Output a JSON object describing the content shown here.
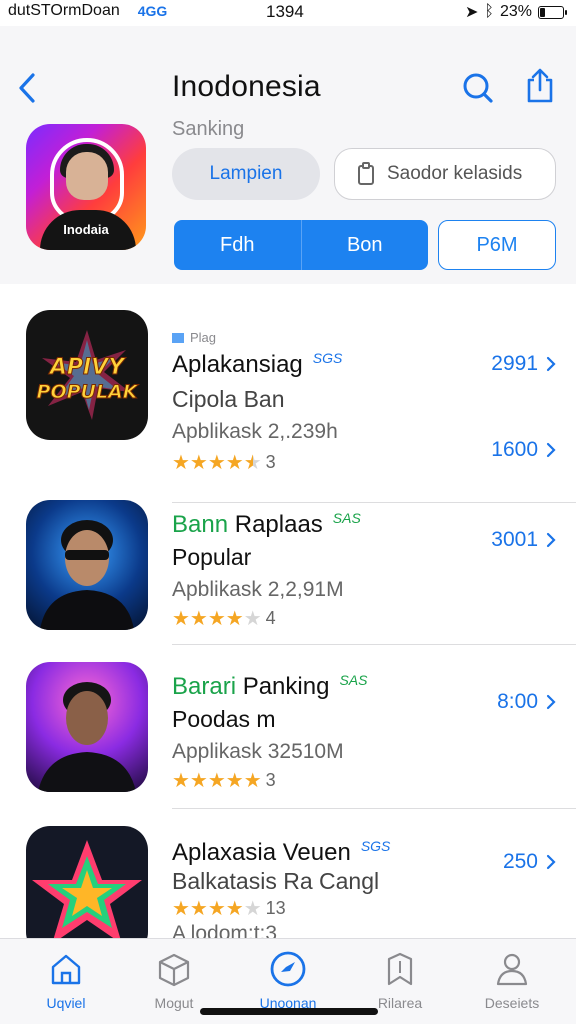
{
  "status_bar": {
    "carrier": "dutSTOrmDoan",
    "network": "4GG",
    "time": "1394",
    "battery": "23%",
    "battery_level": 0.23
  },
  "header": {
    "title": "Inodonesia",
    "subtitle": "Sanking",
    "hero_caption": "Inodaia",
    "primary_button": "Lampien",
    "secondary_button": "Saodor kelasids",
    "segments": [
      "Fdh",
      "Bon"
    ],
    "outline_button": "P6M"
  },
  "list": {
    "items": [
      {
        "flag": "Plag",
        "title_green": "",
        "title": "Aplakansiag",
        "tag": "SGS",
        "line2": "Cipola Ban",
        "meta": "Apblikask 2,.239h",
        "rating": 4.5,
        "rating_count": "3",
        "actions": [
          "2991",
          "1600"
        ],
        "icon": "apivy-popular-icon",
        "icon_text": [
          "APIVY",
          "POPULAK"
        ]
      },
      {
        "title_green": "Bann",
        "title": "Raplaas",
        "tag": "SAS",
        "line2": "Popular",
        "meta": "Apblikask 2,2,91M",
        "rating": 4,
        "rating_count": "4",
        "actions": [
          "3001"
        ],
        "icon": "sunglasses-man-icon"
      },
      {
        "title_green": "Barari",
        "title": "Panking",
        "tag": "SAS",
        "line2": "Poodas m",
        "meta": "Applikask 32510M",
        "rating": 5,
        "rating_count": "3",
        "actions": [
          "8:00"
        ],
        "icon": "man-portrait-icon"
      },
      {
        "title_green": "",
        "title": "Aplaxasia Veuen",
        "tag": "SGS",
        "line2": "Balkatasis Ra Cangl",
        "meta": "A lodom:t:3",
        "rating": 4,
        "rating_count": "13",
        "actions": [
          "250"
        ],
        "icon": "star-logo-icon"
      }
    ]
  },
  "tabbar": {
    "tabs": [
      {
        "label": "Uqviel",
        "icon": "home-icon"
      },
      {
        "label": "Mogut",
        "icon": "box-icon"
      },
      {
        "label": "Unoonan",
        "icon": "compass-icon",
        "active": true
      },
      {
        "label": "Rilarea",
        "icon": "bookmark-icon"
      },
      {
        "label": "Deseiets",
        "icon": "person-icon"
      }
    ]
  },
  "colors": {
    "accent": "#1a73e8",
    "green": "#1aa34a",
    "star": "#f5a623"
  }
}
